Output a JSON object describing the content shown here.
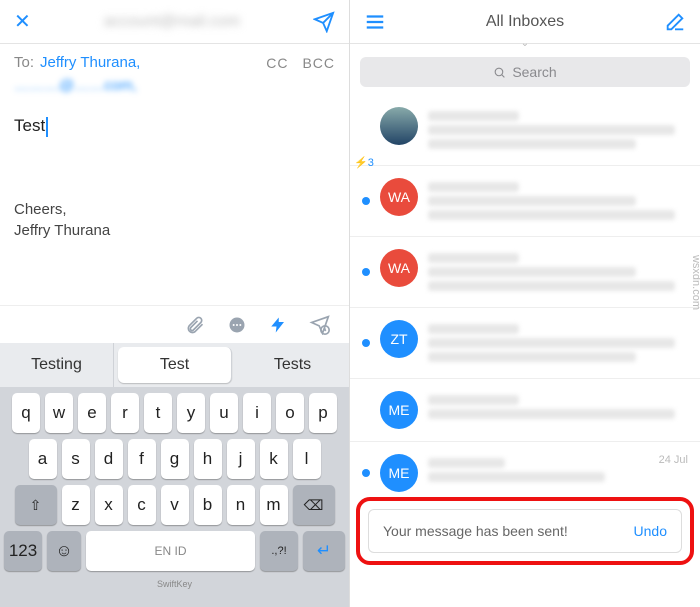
{
  "compose": {
    "to_label": "To:",
    "recipient": "Jeffry Thurana,",
    "second_recipient": "………@……com,",
    "cc": "CC",
    "bcc": "BCC",
    "body": "Test",
    "sig1": "Cheers,",
    "sig2": "Jeffry Thurana"
  },
  "suggestions": {
    "a": "Testing",
    "b": "Test",
    "c": "Tests"
  },
  "keys": {
    "r1": [
      "q",
      "w",
      "e",
      "r",
      "t",
      "y",
      "u",
      "i",
      "o",
      "p"
    ],
    "r2": [
      "a",
      "s",
      "d",
      "f",
      "g",
      "h",
      "j",
      "k",
      "l"
    ],
    "r3": [
      "z",
      "x",
      "c",
      "v",
      "b",
      "n",
      "m"
    ],
    "num": "123",
    "emoji": "☺",
    "lang": "EN ID",
    "punct": ".,?!",
    "brand": "SwiftKey"
  },
  "inbox": {
    "title": "All Inboxes",
    "search": "Search",
    "quick": "⚡3",
    "av": {
      "wa": "WA",
      "zt": "ZT",
      "me": "ME"
    },
    "toast_msg": "Your message has been sent!",
    "toast_undo": "Undo",
    "date": "24 Jul"
  },
  "watermark": "wsxdn.com"
}
